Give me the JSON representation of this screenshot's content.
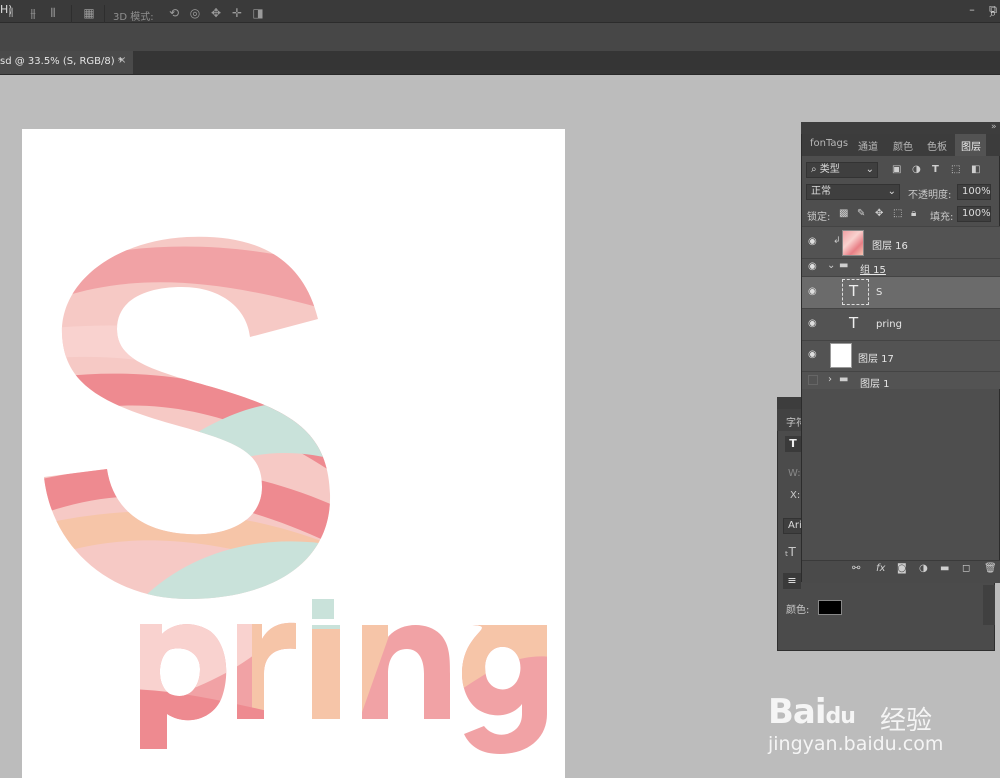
{
  "menubar": {
    "title_fragment": "H)",
    "minimize": "–",
    "restore": "⧉"
  },
  "options": {
    "mode_3d_label": "3D 模式:",
    "search_icon": "search-icon"
  },
  "document_tab": {
    "label": "sd @ 33.5% (S, RGB/8) *",
    "close": "×"
  },
  "artwork": {
    "letter": "S",
    "word": "pring"
  },
  "layers_panel": {
    "tabs": [
      "fonTags",
      "通道",
      "颜色",
      "色板",
      "图层"
    ],
    "active_tab": "图层",
    "filter_label": "类型",
    "blend_mode": "正常",
    "opacity_label": "不透明度:",
    "opacity_value": "100%",
    "lock_label": "锁定:",
    "fill_label": "填充:",
    "fill_value": "100%",
    "layers": [
      {
        "name": "图层 16",
        "visible": true,
        "kind": "image"
      },
      {
        "name": "组 15",
        "visible": true,
        "kind": "group-open"
      },
      {
        "name": "S",
        "visible": true,
        "kind": "text",
        "selected": true
      },
      {
        "name": "pring",
        "visible": true,
        "kind": "text"
      },
      {
        "name": "图层 17",
        "visible": true,
        "kind": "image-white"
      },
      {
        "name": "图层 1",
        "visible": false,
        "kind": "group-closed"
      }
    ],
    "footer_fx": "fx"
  },
  "character_panel": {
    "tab_fragment": "字符",
    "w_label": "W:",
    "x_label": "X:",
    "font_fragment": "Aria",
    "color_label": "颜色:",
    "color_value": "#000000"
  },
  "watermark": {
    "logo": "Bai",
    "logo2": "du",
    "cn": "经验",
    "url": "jingyan.baidu.com"
  }
}
